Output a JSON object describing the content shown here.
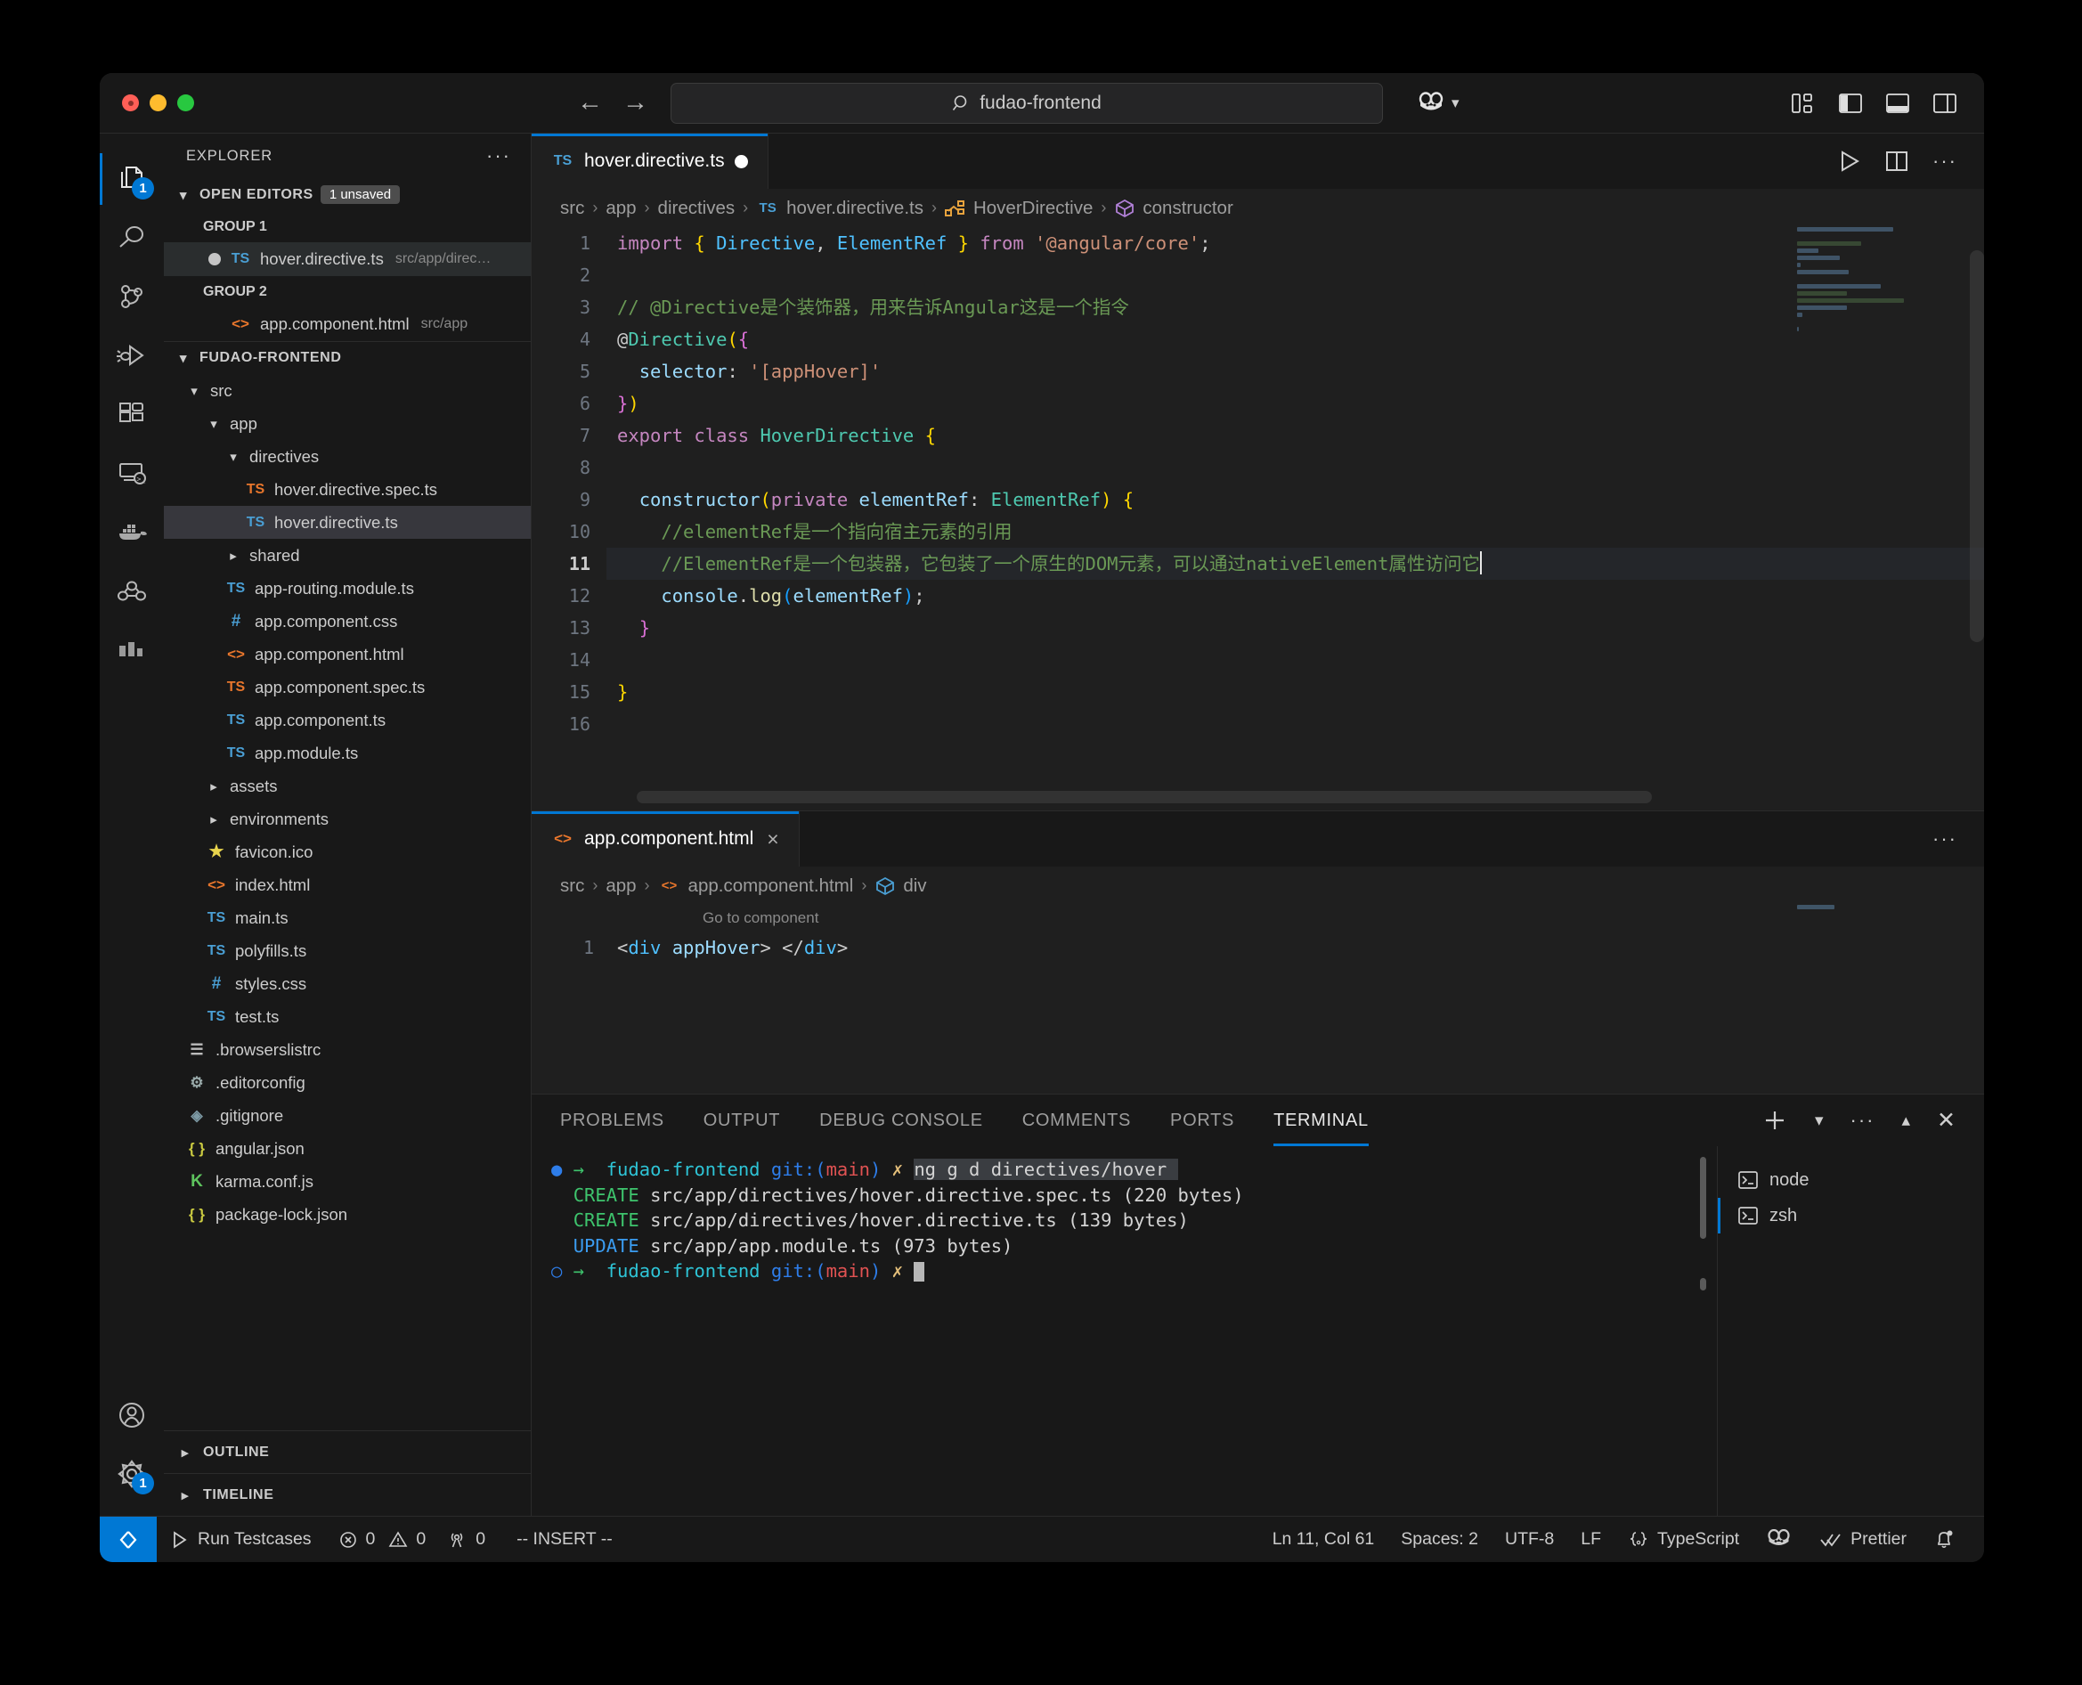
{
  "titlebar": {
    "search_value": "fudao-frontend",
    "back_icon": "arrow-left-icon",
    "forward_icon": "arrow-right-icon",
    "search_icon": "search-icon",
    "copilot_icon": "copilot-icon",
    "layout_icons": [
      "customize-layout-icon",
      "toggle-primary-sidebar-icon",
      "toggle-panel-icon",
      "toggle-secondary-sidebar-icon"
    ]
  },
  "activitybar": {
    "items": [
      {
        "name": "explorer",
        "icon": "files-icon",
        "badge": "1",
        "active": true
      },
      {
        "name": "search",
        "icon": "search-icon",
        "badge": "",
        "active": false
      },
      {
        "name": "source-control",
        "icon": "source-control-icon",
        "badge": "",
        "active": false
      },
      {
        "name": "run-and-debug",
        "icon": "debug-icon",
        "badge": "",
        "active": false
      },
      {
        "name": "extensions",
        "icon": "extensions-icon",
        "badge": "",
        "active": false
      },
      {
        "name": "remote-explorer",
        "icon": "remote-explorer-icon",
        "badge": "",
        "active": false
      },
      {
        "name": "docker",
        "icon": "docker-icon",
        "badge": "",
        "active": false
      },
      {
        "name": "kubernetes",
        "icon": "kubernetes-icon",
        "badge": "",
        "active": false
      },
      {
        "name": "test-explorer",
        "icon": "bar-chart-icon",
        "badge": "",
        "active": false
      }
    ],
    "bottom": [
      {
        "name": "accounts",
        "icon": "account-icon",
        "badge": ""
      },
      {
        "name": "settings",
        "icon": "gear-icon",
        "badge": "1"
      }
    ]
  },
  "sidebar": {
    "title": "EXPLORER",
    "more_actions": "···",
    "open_editors": {
      "label": "OPEN EDITORS",
      "badge": "1 unsaved",
      "groups": [
        {
          "label": "GROUP 1",
          "items": [
            {
              "name": "hover.directive.ts",
              "path": "src/app/direc…",
              "icon": "ts-file-icon",
              "dirty": true,
              "selected": true
            }
          ]
        },
        {
          "label": "GROUP 2",
          "items": [
            {
              "name": "app.component.html",
              "path": "src/app",
              "icon": "html-file-icon",
              "dirty": false,
              "selected": false
            }
          ]
        }
      ]
    },
    "workspace": {
      "label": "FUDAO-FRONTEND",
      "tree": [
        {
          "label": "src",
          "depth": 0,
          "type": "folder",
          "open": true,
          "icon": ""
        },
        {
          "label": "app",
          "depth": 1,
          "type": "folder",
          "open": true,
          "icon": ""
        },
        {
          "label": "directives",
          "depth": 2,
          "type": "folder",
          "open": true,
          "icon": ""
        },
        {
          "label": "hover.directive.spec.ts",
          "depth": 3,
          "type": "file",
          "icon": "ts-spec-icon"
        },
        {
          "label": "hover.directive.ts",
          "depth": 3,
          "type": "file",
          "icon": "ts-file-icon",
          "selected": true
        },
        {
          "label": "shared",
          "depth": 2,
          "type": "folder",
          "open": false,
          "icon": ""
        },
        {
          "label": "app-routing.module.ts",
          "depth": 2,
          "type": "file",
          "icon": "ts-file-icon"
        },
        {
          "label": "app.component.css",
          "depth": 2,
          "type": "file",
          "icon": "css-file-icon"
        },
        {
          "label": "app.component.html",
          "depth": 2,
          "type": "file",
          "icon": "html-file-icon"
        },
        {
          "label": "app.component.spec.ts",
          "depth": 2,
          "type": "file",
          "icon": "ts-spec-icon"
        },
        {
          "label": "app.component.ts",
          "depth": 2,
          "type": "file",
          "icon": "ts-file-icon"
        },
        {
          "label": "app.module.ts",
          "depth": 2,
          "type": "file",
          "icon": "ts-file-icon"
        },
        {
          "label": "assets",
          "depth": 1,
          "type": "folder",
          "open": false,
          "icon": ""
        },
        {
          "label": "environments",
          "depth": 1,
          "type": "folder",
          "open": false,
          "icon": ""
        },
        {
          "label": "favicon.ico",
          "depth": 1,
          "type": "file",
          "icon": "favicon-icon"
        },
        {
          "label": "index.html",
          "depth": 1,
          "type": "file",
          "icon": "html-file-icon"
        },
        {
          "label": "main.ts",
          "depth": 1,
          "type": "file",
          "icon": "ts-file-icon"
        },
        {
          "label": "polyfills.ts",
          "depth": 1,
          "type": "file",
          "icon": "ts-file-icon"
        },
        {
          "label": "styles.css",
          "depth": 1,
          "type": "file",
          "icon": "css-file-icon"
        },
        {
          "label": "test.ts",
          "depth": 1,
          "type": "file",
          "icon": "ts-file-icon"
        },
        {
          "label": ".browserslistrc",
          "depth": 0,
          "type": "file",
          "icon": "list-icon"
        },
        {
          "label": ".editorconfig",
          "depth": 0,
          "type": "file",
          "icon": "gear-file-icon"
        },
        {
          "label": ".gitignore",
          "depth": 0,
          "type": "file",
          "icon": "git-icon"
        },
        {
          "label": "angular.json",
          "depth": 0,
          "type": "file",
          "icon": "json-file-icon"
        },
        {
          "label": "karma.conf.js",
          "depth": 0,
          "type": "file",
          "icon": "karma-icon"
        },
        {
          "label": "package-lock.json",
          "depth": 0,
          "type": "file",
          "icon": "json-file-icon"
        }
      ]
    },
    "outline_label": "OUTLINE",
    "timeline_label": "TIMELINE"
  },
  "editor1": {
    "tab": {
      "label": "hover.directive.ts",
      "icon": "ts-file-icon",
      "dirty": true
    },
    "actions": [
      "run-icon",
      "split-editor-icon",
      "more-actions-icon"
    ],
    "breadcrumb": [
      "src",
      "app",
      "directives",
      "hover.directive.ts",
      "HoverDirective",
      "constructor"
    ],
    "breadcrumb_icons": [
      "",
      "",
      "",
      "ts-file-icon",
      "interface-icon",
      "method-icon"
    ],
    "lines": [
      {
        "n": "1",
        "tokens": [
          [
            "kw",
            "import"
          ],
          [
            "plain",
            " "
          ],
          [
            "pun",
            "{"
          ],
          [
            "plain",
            " "
          ],
          [
            "cls",
            "Directive"
          ],
          [
            "plain",
            ", "
          ],
          [
            "cls",
            "ElementRef"
          ],
          [
            "plain",
            " "
          ],
          [
            "pun",
            "}"
          ],
          [
            "plain",
            " "
          ],
          [
            "kw",
            "from"
          ],
          [
            "plain",
            " "
          ],
          [
            "str",
            "'@angular/core'"
          ],
          [
            "plain",
            ";"
          ]
        ]
      },
      {
        "n": "2",
        "tokens": []
      },
      {
        "n": "3",
        "tokens": [
          [
            "cmt",
            "// @Directive是个装饰器，用来告诉Angular这是一个指令"
          ]
        ]
      },
      {
        "n": "4",
        "tokens": [
          [
            "plain",
            "@"
          ],
          [
            "typ",
            "Directive"
          ],
          [
            "pun",
            "("
          ],
          [
            "pun2",
            "{"
          ]
        ]
      },
      {
        "n": "5",
        "tokens": [
          [
            "plain",
            "  "
          ],
          [
            "var",
            "selector"
          ],
          [
            "plain",
            ": "
          ],
          [
            "str",
            "'[appHover]'"
          ]
        ]
      },
      {
        "n": "6",
        "tokens": [
          [
            "pun2",
            "}"
          ],
          [
            "pun",
            ")"
          ]
        ]
      },
      {
        "n": "7",
        "tokens": [
          [
            "kw",
            "export"
          ],
          [
            "plain",
            " "
          ],
          [
            "kw",
            "class"
          ],
          [
            "plain",
            " "
          ],
          [
            "typ",
            "HoverDirective"
          ],
          [
            "plain",
            " "
          ],
          [
            "pun",
            "{"
          ]
        ]
      },
      {
        "n": "8",
        "tokens": []
      },
      {
        "n": "9",
        "tokens": [
          [
            "plain",
            "  "
          ],
          [
            "var",
            "constructor"
          ],
          [
            "pun",
            "("
          ],
          [
            "kw",
            "private"
          ],
          [
            "plain",
            " "
          ],
          [
            "param",
            "elementRef"
          ],
          [
            "plain",
            ": "
          ],
          [
            "typ",
            "ElementRef"
          ],
          [
            "pun",
            ")"
          ],
          [
            "plain",
            " "
          ],
          [
            "pun",
            "{"
          ]
        ]
      },
      {
        "n": "10",
        "tokens": [
          [
            "plain",
            "    "
          ],
          [
            "cmt",
            "//elementRef是一个指向宿主元素的引用"
          ]
        ]
      },
      {
        "n": "11",
        "tokens": [
          [
            "plain",
            "    "
          ],
          [
            "cmt",
            "//ElementRef是一个包装器，它包装了一个原生的DOM元素，可以通过nativeElement属性访问它"
          ]
        ],
        "current": true
      },
      {
        "n": "12",
        "tokens": [
          [
            "plain",
            "    "
          ],
          [
            "var",
            "console"
          ],
          [
            "plain",
            "."
          ],
          [
            "fn",
            "log"
          ],
          [
            "pun3",
            "("
          ],
          [
            "param",
            "elementRef"
          ],
          [
            "pun3",
            ")"
          ],
          [
            "plain",
            ";"
          ]
        ]
      },
      {
        "n": "13",
        "tokens": [
          [
            "plain",
            "  "
          ],
          [
            "pun2",
            "}"
          ]
        ]
      },
      {
        "n": "14",
        "tokens": []
      },
      {
        "n": "15",
        "tokens": [
          [
            "pun",
            "}"
          ]
        ]
      },
      {
        "n": "16",
        "tokens": []
      }
    ]
  },
  "editor2": {
    "tab": {
      "label": "app.component.html",
      "icon": "html-file-icon",
      "close": "×"
    },
    "actions": [
      "more-actions-icon"
    ],
    "breadcrumb": [
      "src",
      "app",
      "app.component.html",
      "div"
    ],
    "codelens": "Go to component",
    "lines": [
      {
        "n": "1",
        "tokens": [
          [
            "plain",
            "<"
          ],
          [
            "cls",
            "div"
          ],
          [
            "plain",
            " "
          ],
          [
            "var",
            "appHover"
          ],
          [
            "plain",
            "> </"
          ],
          [
            "cls",
            "div"
          ],
          [
            "plain",
            ">"
          ]
        ]
      }
    ]
  },
  "panel": {
    "tabs": [
      "PROBLEMS",
      "OUTPUT",
      "DEBUG CONSOLE",
      "COMMENTS",
      "PORTS",
      "TERMINAL"
    ],
    "active_tab": "TERMINAL",
    "actions": [
      "new-terminal-icon",
      "chevron-down-icon",
      "more-actions-icon",
      "maximize-panel-icon",
      "close-panel-icon"
    ],
    "terminal_lines": [
      {
        "type": "prompt",
        "bullet": "●",
        "arrow": "→",
        "dir": "fudao-frontend",
        "git": "git:(",
        "branch": "main",
        "gitclose": ")",
        "mark": "✗",
        "command": "ng g d directives/hover",
        "selected": true
      },
      {
        "type": "out",
        "tag": "CREATE",
        "tagcolor": "green",
        "text": "src/app/directives/hover.directive.spec.ts (220 bytes)"
      },
      {
        "type": "out",
        "tag": "CREATE",
        "tagcolor": "green",
        "text": "src/app/directives/hover.directive.ts (139 bytes)"
      },
      {
        "type": "out",
        "tag": "UPDATE",
        "tagcolor": "lblue",
        "text": "src/app/app.module.ts (973 bytes)"
      },
      {
        "type": "prompt",
        "bullet": "○",
        "arrow": "→",
        "dir": "fudao-frontend",
        "git": "git:(",
        "branch": "main",
        "gitclose": ")",
        "mark": "✗",
        "command": "",
        "selected": false
      }
    ],
    "terminal_list": [
      {
        "label": "node",
        "icon": "terminal-icon",
        "selected": false
      },
      {
        "label": "zsh",
        "icon": "terminal-icon",
        "selected": true
      }
    ]
  },
  "statusbar": {
    "remote_icon": "remote-window-icon",
    "left": [
      {
        "name": "run-testcases",
        "icon": "play-icon",
        "label": "Run Testcases"
      },
      {
        "name": "errors",
        "icon": "error-icon",
        "label": "0"
      },
      {
        "name": "warnings",
        "icon": "warning-icon",
        "label": "0"
      },
      {
        "name": "ports",
        "icon": "radio-tower-icon",
        "label": "0"
      },
      {
        "name": "vim-mode",
        "icon": "",
        "label": "-- INSERT --"
      }
    ],
    "right": [
      {
        "name": "cursor-position",
        "icon": "",
        "label": "Ln 11, Col 61"
      },
      {
        "name": "indentation",
        "icon": "",
        "label": "Spaces: 2"
      },
      {
        "name": "encoding",
        "icon": "",
        "label": "UTF-8"
      },
      {
        "name": "eol",
        "icon": "",
        "label": "LF"
      },
      {
        "name": "language-mode",
        "icon": "braces-icon",
        "label": "TypeScript"
      },
      {
        "name": "copilot-status",
        "icon": "copilot-icon",
        "label": ""
      },
      {
        "name": "prettier",
        "icon": "check-icon",
        "label": "Prettier"
      },
      {
        "name": "notifications",
        "icon": "bell-dot-icon",
        "label": ""
      }
    ]
  },
  "colors": {
    "accent": "#0078d4",
    "bg": "#1f1f1f",
    "bg_alt": "#181818",
    "text": "#cccccc",
    "comment": "#6a9955",
    "string": "#ce9178",
    "keyword": "#c586c0"
  }
}
